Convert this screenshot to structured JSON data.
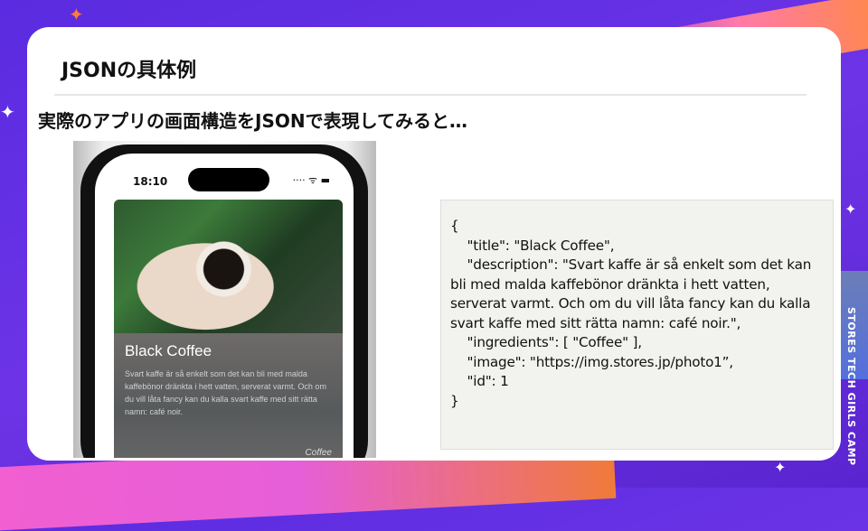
{
  "slide": {
    "title": "JSONの具体例",
    "subtitle": "実際のアプリの画面構造をJSONで表現してみると…",
    "brand": "STORES TECH GIRLS CAMP"
  },
  "phone": {
    "time": "18:10",
    "status_icons": "···· ᯤ ▬",
    "card": {
      "title": "Black Coffee",
      "description": "Svart kaffe är så enkelt som det kan bli med malda kaffebönor dränkta i hett vatten, serverat varmt. Och om du vill låta fancy kan du kalla svart kaffe med sitt rätta namn: café noir.",
      "ingredient": "Coffee"
    }
  },
  "code": "{\n    \"title\": \"Black Coffee\",\n    \"description\": \"Svart kaffe är så enkelt som det kan bli med malda kaffebönor dränkta i hett vatten, serverat varmt. Och om du vill låta fancy kan du kalla svart kaffe med sitt rätta namn: café noir.\",\n    \"ingredients\": [ \"Coffee\" ],\n    \"image\": \"https://img.stores.jp/photo1”,\n    \"id\": 1\n}",
  "colors": {
    "background": "#6030e0",
    "card": "#ffffff",
    "code_bg": "#f2f2ee"
  }
}
